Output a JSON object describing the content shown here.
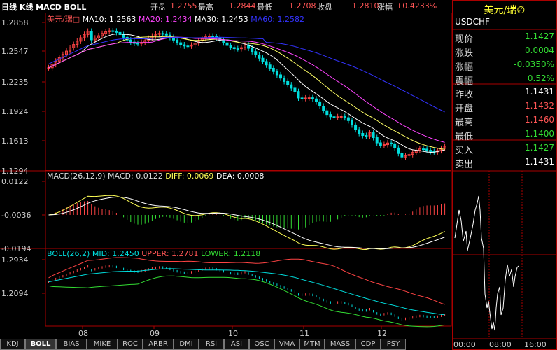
{
  "header": {
    "period_label": "日线 K线 MACD BOLL",
    "open_label": "开盘",
    "open_value": "1.2755",
    "high_label": "最高",
    "high_value": "1.2844",
    "low_label": "最低",
    "low_value": "1.2708",
    "close_label": "收盘",
    "close_value": "1.2810",
    "change_label": "涨幅",
    "change_value": "+0.4233%"
  },
  "main_panel": {
    "name": "美元/瑞□",
    "ma10": "MA10: 1.2563",
    "ma20": "MA20: 1.2434",
    "ma30": "MA30: 1.2453",
    "ma60": "MA60: 1.2582",
    "y_ticks": [
      "1.2858",
      "1.2547",
      "1.2235",
      "1.1924",
      "1.1613",
      "1.1294"
    ]
  },
  "macd_panel": {
    "title": "MACD(26,12,9)",
    "macd": "MACD: 0.0122",
    "diff": "DIFF: 0.0069",
    "dea": "DEA: 0.0008",
    "y_ticks": [
      "0.0122",
      "-0.0036",
      "-0.0194"
    ]
  },
  "boll_panel": {
    "title": "BOLL(26,2)",
    "mid": "MID: 1.2450",
    "upper": "UPPER: 1.2781",
    "lower": "LOWER: 1.2118",
    "y_ticks": [
      "1.2934",
      "1.2094"
    ]
  },
  "x_ticks": [
    "08",
    "09",
    "10",
    "11",
    "12"
  ],
  "quote": {
    "title": "美元/瑞∅",
    "symbol": "USDCHF",
    "rows": [
      {
        "label": "现价",
        "value": "1.1427",
        "color": "#33dd33"
      },
      {
        "label": "涨跌",
        "value": "0.0004",
        "color": "#33dd33"
      },
      {
        "label": "涨幅",
        "value": "-0.0350%",
        "color": "#33dd33"
      },
      {
        "label": "震幅",
        "value": "0.52%",
        "color": "#33dd33"
      },
      {
        "label": "昨收",
        "value": "1.1431",
        "color": "#ffffff"
      },
      {
        "label": "开盘",
        "value": "1.1432",
        "color": "#ff5555"
      },
      {
        "label": "最高",
        "value": "1.1460",
        "color": "#ff5555"
      },
      {
        "label": "最低",
        "value": "1.1400",
        "color": "#33dd33"
      },
      {
        "label": "买入",
        "value": "1.1427",
        "color": "#33dd33"
      },
      {
        "label": "卖出",
        "value": "1.1431",
        "color": "#ffffff"
      }
    ],
    "intraday_ticks": [
      "00:00",
      "08:00",
      "16:00"
    ]
  },
  "tabs": [
    "KDJ",
    "BOLL",
    "BIAS",
    "MIKE",
    "ROC",
    "ARBR",
    "DMI",
    "RSI",
    "ASI",
    "OSC",
    "VMA",
    "MTM",
    "MASS",
    "CDP",
    "PSY"
  ],
  "active_tab": "BOLL",
  "colors": {
    "up": "#ff4444",
    "down": "#00dddd",
    "ma10": "#ffffff",
    "ma20": "#ffff66",
    "ma30": "#ff44ff",
    "ma60": "#3333ff",
    "grid": "#aa0000"
  }
}
